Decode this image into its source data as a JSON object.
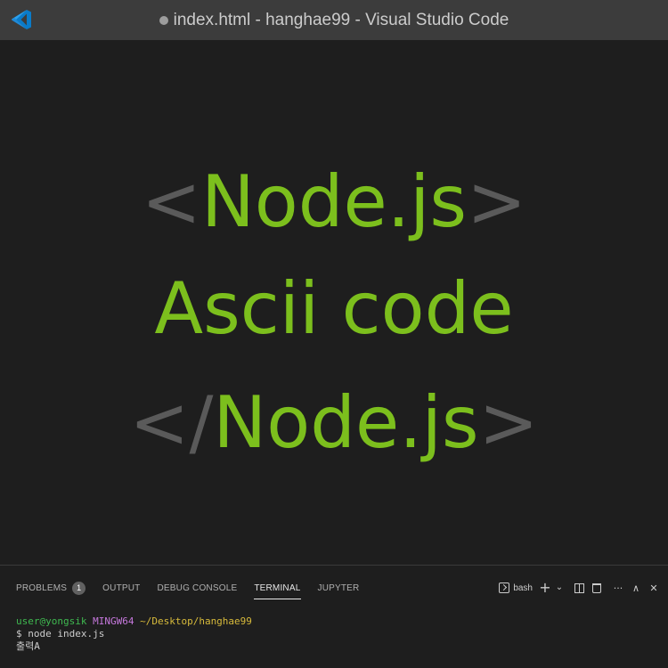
{
  "window": {
    "title": "index.html - hanghae99 - Visual Studio Code",
    "app_icon": "vscode-logo-icon",
    "dirty_indicator": "dirty-dot-icon"
  },
  "editor": {
    "banner": {
      "line1": {
        "open": "<",
        "text": "Node.js",
        "close": ">"
      },
      "line2": {
        "text": "Ascii code"
      },
      "line3": {
        "open": "</",
        "text": "Node.js",
        "close": ">"
      }
    },
    "colors": {
      "green": "#7cbf1d",
      "bracket": "#5a5a5a",
      "background": "#1e1e1e"
    }
  },
  "panel": {
    "tabs": [
      {
        "label": "PROBLEMS",
        "badge": "1"
      },
      {
        "label": "OUTPUT"
      },
      {
        "label": "DEBUG CONSOLE"
      },
      {
        "label": "TERMINAL",
        "active": true
      },
      {
        "label": "JUPYTER"
      }
    ],
    "actions": {
      "shell_label": "bash",
      "add_glyph": "+",
      "chevron_glyph": "⌄",
      "more_glyph": "···",
      "maximize_glyph": "∧",
      "close_glyph": "✕"
    },
    "terminal": {
      "user": "user@yongsik",
      "host": "MINGW64",
      "path": "~/Desktop/hanghae99",
      "command": "$ node index.js",
      "output": "출력A"
    }
  }
}
